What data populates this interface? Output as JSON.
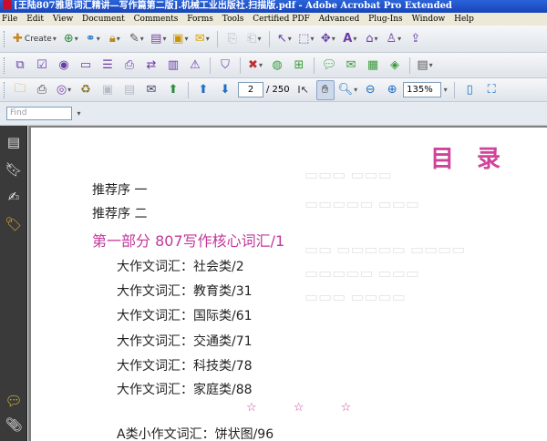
{
  "window": {
    "title": "[王陆807雅思词汇精讲—写作篇第二版].机械工业出版社.扫描版.pdf - Adobe Acrobat Pro Extended"
  },
  "menubar": [
    "File",
    "Edit",
    "View",
    "Document",
    "Comments",
    "Forms",
    "Tools",
    "Certified PDF",
    "Advanced",
    "Plug-Ins",
    "Window",
    "Help"
  ],
  "toolbar": {
    "create_label": "Create",
    "page_current": "2",
    "page_total": "/ 250",
    "zoom": "135%",
    "find_placeholder": "Find"
  },
  "document": {
    "title": "目 录",
    "toc": [
      {
        "text": "推荐序 一"
      },
      {
        "text": "推荐序 二"
      },
      {
        "text": "第一部分 807写作核心词汇/1"
      },
      {
        "text": "大作文词汇：社会类/2"
      },
      {
        "text": "大作文词汇：教育类/31"
      },
      {
        "text": "大作文词汇：国际类/61"
      },
      {
        "text": "大作文词汇：交通类/71"
      },
      {
        "text": "大作文词汇：科技类/78"
      },
      {
        "text": "大作文词汇：家庭类/88"
      },
      {
        "text": "A类小作文词汇：饼状图/96"
      }
    ],
    "stars": "☆ ☆ ☆"
  }
}
